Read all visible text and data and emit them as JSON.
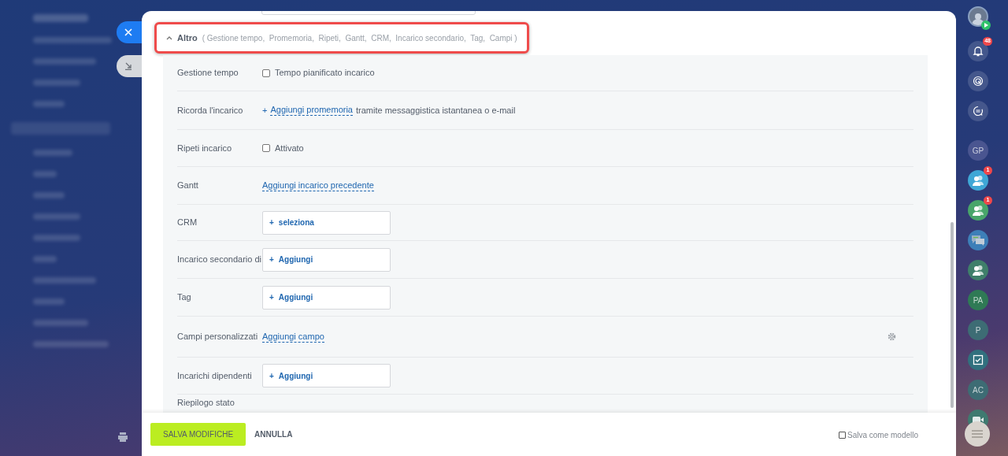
{
  "section": {
    "title": "Altro",
    "expanded": true,
    "summary": "( Gestione tempo,  Promemoria,  Ripeti,  Gantt,  CRM,  Incarico secondario,  Tag,  Campi )"
  },
  "rows": [
    {
      "label": "Gestione tempo",
      "kind": "checkbox",
      "checked": false,
      "text": "Tempo pianificato incarico"
    },
    {
      "label": "Ricorda l'incarico",
      "kind": "link",
      "plus": "+",
      "link": "Aggiungi promemoria",
      "text": "tramite messaggistica istantanea o e-mail"
    },
    {
      "label": "Ripeti incarico",
      "kind": "checkbox",
      "checked": false,
      "text": "Attivato"
    },
    {
      "label": "Gantt",
      "kind": "link",
      "link": "Aggiungi incarico precedente"
    },
    {
      "label": "CRM",
      "kind": "picker",
      "plus": "+",
      "button": "seleziona"
    },
    {
      "label": "Incarico secondario di",
      "kind": "picker",
      "plus": "+",
      "button": "Aggiungi"
    },
    {
      "label": "Tag",
      "kind": "picker",
      "plus": "+",
      "button": "Aggiungi"
    },
    {
      "label": "Campi personalizzati",
      "kind": "link",
      "link": "Aggiungi campo",
      "gear": true
    },
    {
      "label": "Incarichi dipendenti",
      "kind": "picker",
      "plus": "+",
      "button": "Aggiungi"
    },
    {
      "label": "Riepilogo stato",
      "kind": "partial"
    }
  ],
  "footer": {
    "save": "SALVA MODIFICHE",
    "cancel": "ANNULLA",
    "template": {
      "label": "Salva come modello",
      "checked": false
    }
  },
  "right_bar": [
    {
      "kind": "avatar"
    },
    {
      "kind": "bell",
      "badge": "48"
    },
    {
      "kind": "target"
    },
    {
      "kind": "chat"
    },
    {
      "kind": "initials",
      "text": "GP",
      "color": "#4a5590"
    },
    {
      "kind": "group",
      "badge": "1",
      "color": "#3fa7d6"
    },
    {
      "kind": "group",
      "badge": "1",
      "color": "#48a56a"
    },
    {
      "kind": "messages",
      "color": "#3d7fb8"
    },
    {
      "kind": "group",
      "color": "#3f7f6a"
    },
    {
      "kind": "initials",
      "text": "PA",
      "color": "#2f7a55"
    },
    {
      "kind": "initials",
      "text": "P",
      "color": "#3d6c74"
    },
    {
      "kind": "task",
      "color": "#31707e"
    },
    {
      "kind": "initials",
      "text": "AC",
      "color": "#3d6c74"
    },
    {
      "kind": "video",
      "color": "#3f7a70"
    }
  ]
}
